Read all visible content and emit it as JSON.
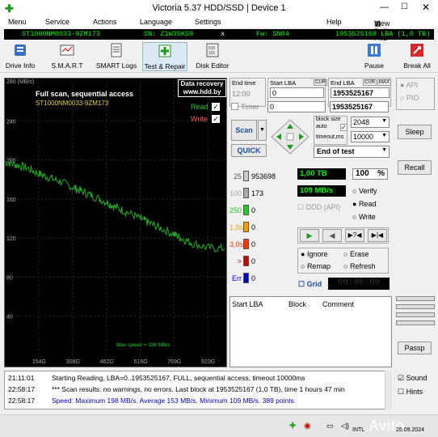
{
  "window": {
    "title": "Victoria 5.37 HDD/SSD | Device 1"
  },
  "menu": {
    "items": [
      "Menu",
      "Service",
      "Actions",
      "Language",
      "Settings",
      "Help"
    ],
    "right_item": "View Buffer Live"
  },
  "device_bar": {
    "model": "ST1000NM0033-9ZM173",
    "sn": "SN: Z1W35KS9",
    "x": "x",
    "fw": "Fw: SN04",
    "lba_size": "1953525168 LBA (1,0 TB)"
  },
  "toolbar": {
    "drive_info": "Drive Info",
    "smart": "S.M.A.R.T",
    "smart_logs": "SMART Logs",
    "test_repair": "Test & Repair",
    "disk_editor": "Disk Editor",
    "pause": "Pause",
    "break_all": "Break All"
  },
  "graph": {
    "max_label": "280 (MB/s)",
    "y_ticks": [
      "240",
      "200",
      "160",
      "120",
      "80",
      "40"
    ],
    "x_ticks": [
      "154G",
      "308G",
      "462G",
      "616G",
      "769G",
      "923G"
    ],
    "title": "Full scan, sequential access",
    "model": "ST1000NM0033-9ZM173",
    "recovery_line1": "Data recovery",
    "recovery_line2": "www.hdd.by",
    "read_label": "Read",
    "write_label": "Write",
    "max_speed_text": "Max speed = 198 MB/s",
    "line_color": "#22aa22"
  },
  "chart_data": {
    "type": "line",
    "x": [
      0,
      50,
      100,
      154,
      200,
      250,
      308,
      350,
      400,
      462,
      500,
      550,
      616,
      650,
      700,
      769,
      800,
      850,
      923,
      1000
    ],
    "series": [
      {
        "values": [
          198,
          195,
          192,
          186,
          182,
          178,
          172,
          168,
          163,
          157,
          152,
          147,
          140,
          136,
          131,
          124,
          120,
          115,
          110,
          109
        ]
      }
    ],
    "ylim": [
      0,
      280
    ],
    "xlim": [
      0,
      1000
    ]
  },
  "controls": {
    "end_time_label": "End time",
    "end_time_value": "12:00",
    "timer_label": "Timer",
    "start_lba_label": "Start LBA",
    "cur_label": "CUR",
    "start_lba_value": "0",
    "timer_value": "0",
    "end_lba_label": "End LBA",
    "cur_label2": "CUR",
    "max_label": "MAX",
    "end_lba_value": "1953525167",
    "end_lba_value2": "1953525167",
    "scan_label": "Scan",
    "quick_label": "QUICK",
    "block_size_label": "block size",
    "auto_label": "auto",
    "block_size_value": "2048",
    "timeout_label": "timeout,ms",
    "timeout_value": "10000",
    "end_of_test": "End of test",
    "api_label": "API",
    "pio_label": "PIO",
    "sleep_label": "Sleep",
    "recall_label": "Recall",
    "passp_label": "Passp"
  },
  "stats": {
    "rows": [
      {
        "label": "25",
        "count": "953698",
        "color": "#cccccc"
      },
      {
        "label": "100",
        "count": "173",
        "color": "#aaaaaa"
      },
      {
        "label": "250",
        "count": "0",
        "color": "#22cc22"
      },
      {
        "label": "1,0s",
        "count": "0",
        "color": "#ff9900"
      },
      {
        "label": "3,0s",
        "count": "0",
        "color": "#ff3300"
      },
      {
        "label": ">",
        "count": "0",
        "color": "#cc0000"
      },
      {
        "label": "Err",
        "count": "0",
        "color": "#0000cc"
      }
    ],
    "size_value": "1,00 TB",
    "percent_value": "100",
    "percent_unit": "%",
    "speed_value": "109 MB/s",
    "verify_label": "Verify",
    "read_label": "Read",
    "write_label": "Write",
    "ddd_label": "DDD (API)",
    "ignore_label": "Ignore",
    "erase_label": "Erase",
    "remap_label": "Remap",
    "refresh_label": "Refresh",
    "grid_label": "Grid",
    "grid_time": "00:00:00"
  },
  "table": {
    "col_start_lba": "Start LBA",
    "col_block": "Block",
    "col_comment": "Comment"
  },
  "log": {
    "lines": [
      {
        "time": "21:11:01",
        "msg": "Starting Reading, LBA=0..1953525167, FULL, sequential access, timeout 10000ms",
        "color": "#000000"
      },
      {
        "time": "22:58:17",
        "msg": "*** Scan results: no warnings, no errors. Last block at 1953525167 (1,0 TB), time 1 hours 47 min",
        "color": "#000000"
      },
      {
        "time": "22:58:17",
        "msg": "Speed: Maximum 198 MB/s. Average 153 MB/s. Minimum 109 MB/s. 389 points.",
        "color": "#0000cc"
      }
    ],
    "sound_label": "Sound",
    "hints_label": "Hints"
  },
  "taskbar": {
    "lang": "INTL",
    "date": "26.09.2024",
    "time": "0:08"
  },
  "watermark": "Avito"
}
